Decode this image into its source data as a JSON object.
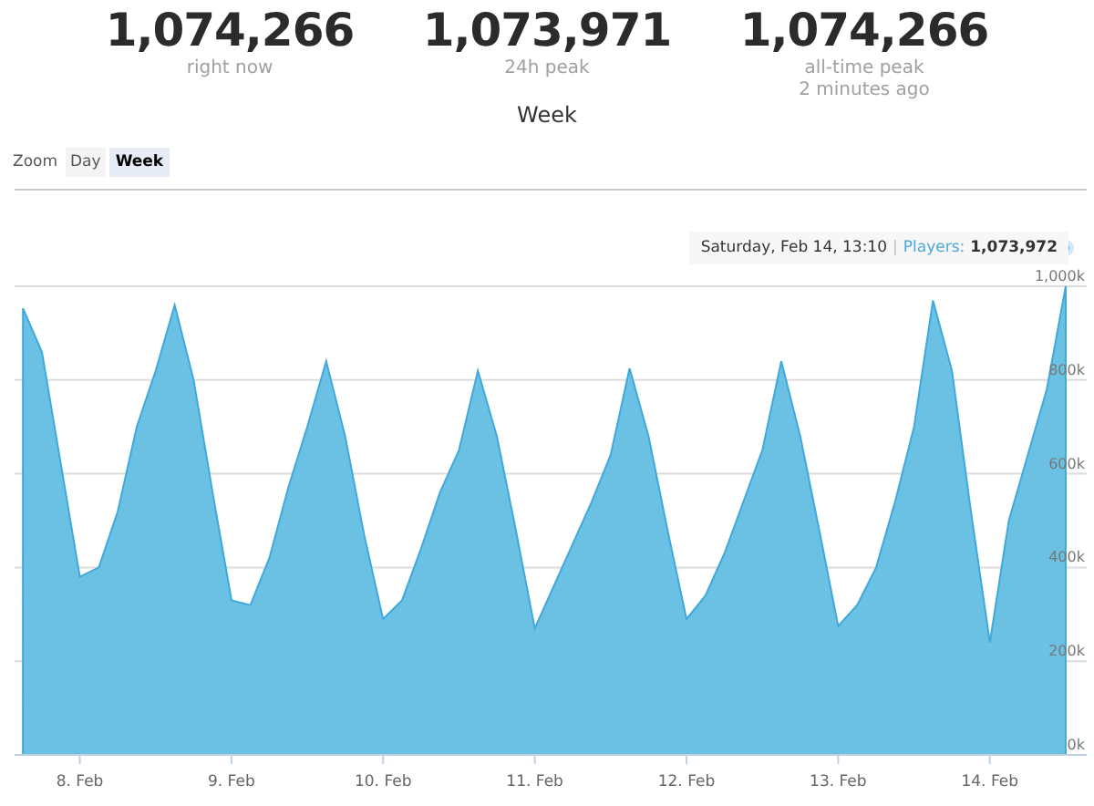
{
  "stats": [
    {
      "value": "1,074,266",
      "label": "right now"
    },
    {
      "value": "1,073,971",
      "label": "24h peak"
    },
    {
      "value": "1,074,266",
      "label": "all-time peak",
      "note": "2 minutes ago"
    }
  ],
  "chart_title": "Week",
  "zoom": {
    "label": "Zoom",
    "options": [
      {
        "label": "Day",
        "selected": false
      },
      {
        "label": "Week",
        "selected": true
      }
    ]
  },
  "tooltip": {
    "date": "Saturday, Feb 14, 13:10",
    "separator": "|",
    "label": "Players:",
    "value": "1,073,972"
  },
  "chart_data": {
    "type": "area",
    "categories": [
      null,
      null,
      null,
      "8. Feb",
      null,
      null,
      null,
      null,
      null,
      null,
      null,
      "9. Feb",
      null,
      null,
      null,
      null,
      null,
      null,
      null,
      "10. Feb",
      null,
      null,
      null,
      null,
      null,
      null,
      null,
      "11. Feb",
      null,
      null,
      null,
      null,
      null,
      null,
      null,
      "12. Feb",
      null,
      null,
      null,
      null,
      null,
      null,
      null,
      "13. Feb",
      null,
      null,
      null,
      null,
      null,
      null,
      null,
      "14. Feb",
      null,
      null,
      null,
      null
    ],
    "series": [
      {
        "color": "#6bc1e3",
        "values": [
          953,
          860,
          620,
          380,
          400,
          520,
          700,
          820,
          960,
          800,
          560,
          330,
          320,
          420,
          570,
          700,
          840,
          680,
          470,
          290,
          330,
          440,
          560,
          650,
          820,
          680,
          480,
          270,
          360,
          450,
          540,
          640,
          825,
          680,
          480,
          290,
          340,
          430,
          540,
          650,
          840,
          680,
          480,
          275,
          320,
          400,
          540,
          700,
          970,
          820,
          520,
          240,
          500,
          640,
          780,
          1000
        ]
      }
    ],
    "ylim": [
      0,
      1000
    ],
    "grid": true,
    "yticks": [
      {
        "value": 0,
        "label": "0k"
      },
      {
        "value": 200,
        "label": "200k"
      },
      {
        "value": 400,
        "label": "400k"
      },
      {
        "value": 600,
        "label": "600k"
      },
      {
        "value": 800,
        "label": "800k"
      },
      {
        "value": 1000,
        "label": "1,000k"
      }
    ]
  }
}
